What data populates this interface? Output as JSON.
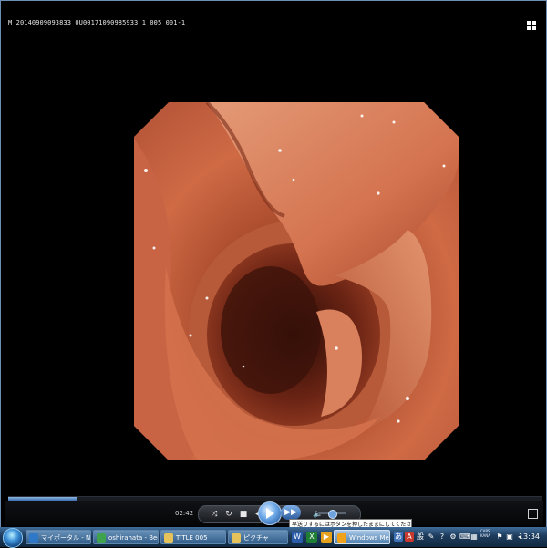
{
  "player": {
    "title": "M_20140909093833_0U00171090985933_1_005_001-1",
    "time": "02:42",
    "progress_fraction": 0.13,
    "volume_fraction": 0.45,
    "tooltip": "早送りするにはボタンを押したままにしてください",
    "icons": {
      "layout": "grid-icon",
      "shuffle": "shuffle-icon",
      "repeat": "repeat-icon",
      "stop": "stop-icon",
      "previous": "previous-icon",
      "play": "play-icon",
      "next": "fast-forward-icon",
      "mute": "speaker-icon",
      "mini": "switch-to-library-icon"
    }
  },
  "taskbar": {
    "items": [
      {
        "label": "マイポータル - Ni..."
      },
      {
        "label": "oshirahata - Bec..."
      },
      {
        "label": "TITLE 005"
      },
      {
        "label": "ピクチャ"
      },
      {
        "label": "Windows Media ..."
      }
    ],
    "clock": "13:34",
    "tray_text": [
      "CAPS",
      "KANA"
    ],
    "quicklaunch": [
      {
        "glyph": "W",
        "color": "#2a5caa"
      },
      {
        "glyph": "X",
        "color": "#1e7e34"
      },
      {
        "glyph": "▶",
        "color": "#e6a21c"
      }
    ]
  },
  "colors": {
    "accent": "#3b6fb0",
    "taskbar": "#1d3b5c",
    "mucosa": "#c8633f"
  }
}
